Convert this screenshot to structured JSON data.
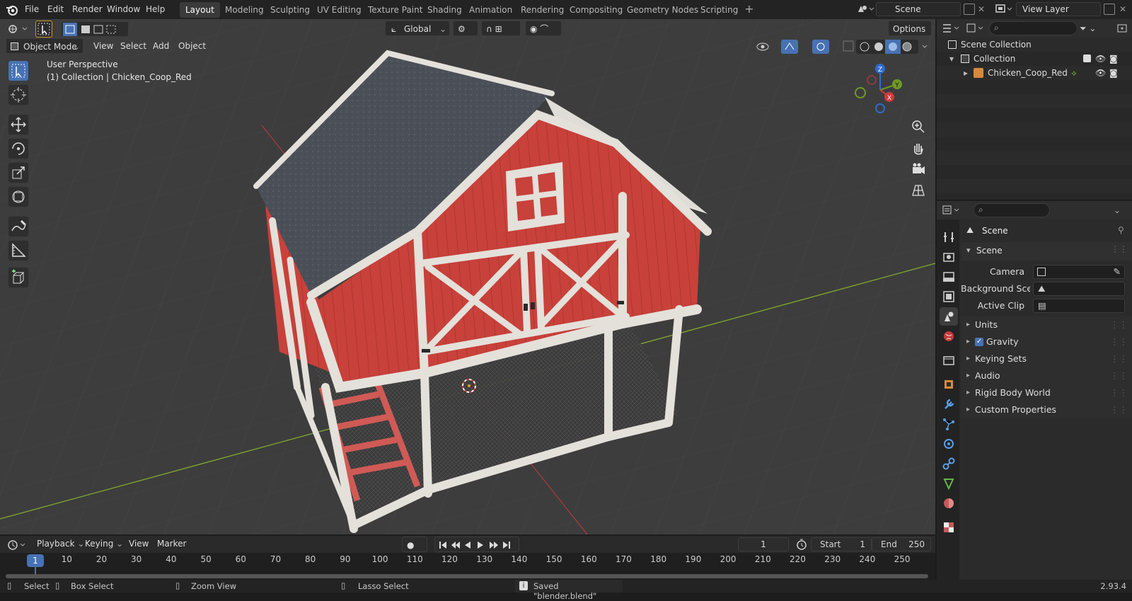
{
  "topbar": {
    "menus": [
      "File",
      "Edit",
      "Render",
      "Window",
      "Help"
    ],
    "workspaces": [
      "Layout",
      "Modeling",
      "Sculpting",
      "UV Editing",
      "Texture Paint",
      "Shading",
      "Animation",
      "Rendering",
      "Compositing",
      "Geometry Nodes",
      "Scripting"
    ],
    "active_workspace": "Layout",
    "scene_name": "Scene",
    "view_layer": "View Layer"
  },
  "viewport_header": {
    "orientation": "Global",
    "options_label": "Options",
    "mode": "Object Mode",
    "menus": [
      "View",
      "Select",
      "Add",
      "Object"
    ]
  },
  "viewport": {
    "perspective_label": "User Perspective",
    "collection_label": "(1) Collection | Chicken_Coop_Red",
    "gizmo_axes": [
      "Z",
      "Y",
      "X"
    ]
  },
  "outliner": {
    "scene_collection": "Scene Collection",
    "collection": "Collection",
    "object": "Chicken_Coop_Red"
  },
  "properties": {
    "context": "Scene",
    "panel": "Scene",
    "fields": [
      {
        "label": "Camera",
        "value": ""
      },
      {
        "label": "Background Sce...",
        "value": ""
      },
      {
        "label": "Active Clip",
        "value": ""
      }
    ],
    "sections": [
      "Units",
      "Gravity",
      "Keying Sets",
      "Audio",
      "Rigid Body World",
      "Custom Properties"
    ],
    "gravity_checked": true
  },
  "timeline": {
    "menus": [
      "Playback",
      "Keying",
      "View",
      "Marker"
    ],
    "current_frame": "1",
    "start_label": "Start",
    "start": "1",
    "end_label": "End",
    "end": "250",
    "ticks": [
      "1",
      "10",
      "20",
      "30",
      "40",
      "50",
      "60",
      "70",
      "80",
      "90",
      "100",
      "110",
      "120",
      "130",
      "140",
      "150",
      "160",
      "170",
      "180",
      "190",
      "200",
      "210",
      "220",
      "230",
      "240",
      "250"
    ]
  },
  "statusbar": {
    "select": "Select",
    "box_select": "Box Select",
    "zoom_view": "Zoom View",
    "lasso_select": "Lasso Select",
    "message": "Saved \"blender.blend\"",
    "version": "2.93.4"
  },
  "colors": {
    "accent": "#4772b3",
    "barn_red": "#c8413a",
    "roof": "#4a4f58",
    "trim": "#e4e0da",
    "x_axis": "#b03a3a",
    "y_axis": "#7fa32e"
  }
}
